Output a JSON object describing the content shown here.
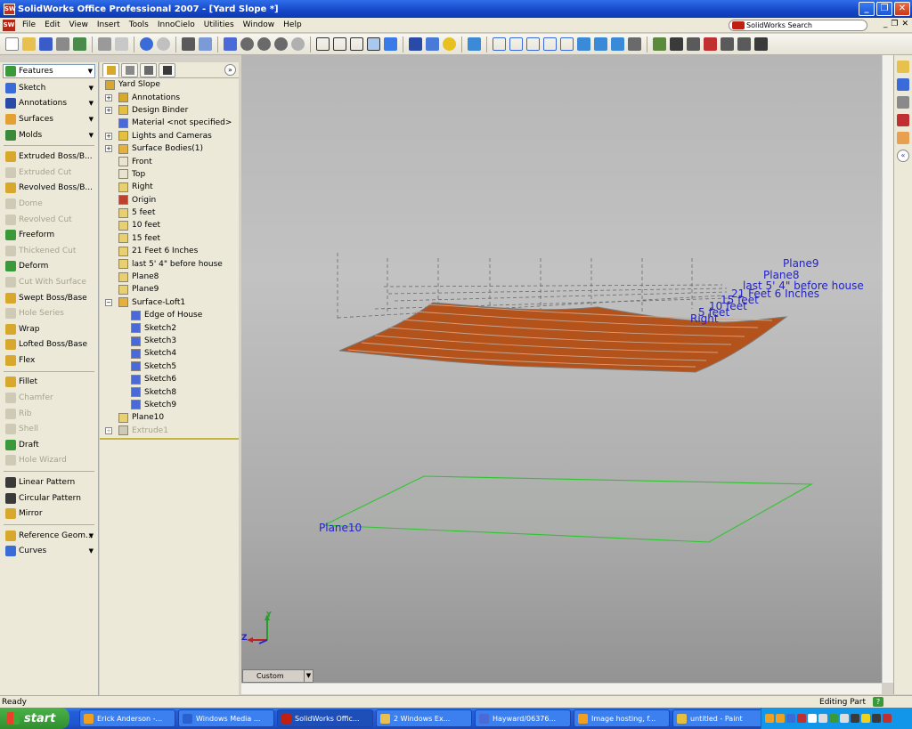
{
  "window": {
    "title": "SolidWorks Office Professional 2007 - [Yard Slope *]",
    "app_icon": "SW"
  },
  "menu": {
    "items": [
      "File",
      "Edit",
      "View",
      "Insert",
      "Tools",
      "InnoCielo",
      "Utilities",
      "Window",
      "Help"
    ],
    "search_placeholder": "SolidWorks Search"
  },
  "command_manager": {
    "selected_tab": "Features",
    "groups": [
      "Sketch",
      "Annotations",
      "Surfaces",
      "Molds"
    ],
    "features": [
      {
        "label": "Extruded Boss/B...",
        "enabled": true,
        "icon": "extrude-boss-icon",
        "color": "#d8a82c"
      },
      {
        "label": "Extruded Cut",
        "enabled": false,
        "icon": "extrude-cut-icon",
        "color": "#cfcab5"
      },
      {
        "label": "Revolved Boss/B...",
        "enabled": true,
        "icon": "revolve-boss-icon",
        "color": "#d8a82c"
      },
      {
        "label": "Dome",
        "enabled": false,
        "icon": "dome-icon",
        "color": "#cfcab5"
      },
      {
        "label": "Revolved Cut",
        "enabled": false,
        "icon": "revolve-cut-icon",
        "color": "#cfcab5"
      },
      {
        "label": "Freeform",
        "enabled": true,
        "icon": "freeform-icon",
        "color": "#3a9a3a"
      },
      {
        "label": "Thickened Cut",
        "enabled": false,
        "icon": "thicken-cut-icon",
        "color": "#cfcab5"
      },
      {
        "label": "Deform",
        "enabled": true,
        "icon": "deform-icon",
        "color": "#3a9a3a"
      },
      {
        "label": "Cut With Surface",
        "enabled": false,
        "icon": "cut-surface-icon",
        "color": "#cfcab5"
      },
      {
        "label": "Swept Boss/Base",
        "enabled": true,
        "icon": "sweep-icon",
        "color": "#d8a82c"
      },
      {
        "label": "Hole Series",
        "enabled": false,
        "icon": "hole-series-icon",
        "color": "#cfcab5"
      },
      {
        "label": "Wrap",
        "enabled": true,
        "icon": "wrap-icon",
        "color": "#d8a82c"
      },
      {
        "label": "Lofted Boss/Base",
        "enabled": true,
        "icon": "loft-icon",
        "color": "#d8a82c"
      },
      {
        "label": "Flex",
        "enabled": true,
        "icon": "flex-icon",
        "color": "#d8a82c"
      },
      {
        "sep": true
      },
      {
        "label": "Fillet",
        "enabled": true,
        "icon": "fillet-icon",
        "color": "#d8a82c"
      },
      {
        "label": "Chamfer",
        "enabled": false,
        "icon": "chamfer-icon",
        "color": "#cfcab5"
      },
      {
        "label": "Rib",
        "enabled": false,
        "icon": "rib-icon",
        "color": "#cfcab5"
      },
      {
        "label": "Shell",
        "enabled": false,
        "icon": "shell-icon",
        "color": "#cfcab5"
      },
      {
        "label": "Draft",
        "enabled": true,
        "icon": "draft-icon",
        "color": "#3a9a3a"
      },
      {
        "label": "Hole Wizard",
        "enabled": false,
        "icon": "hole-wizard-icon",
        "color": "#cfcab5"
      },
      {
        "sep": true
      },
      {
        "label": "Linear Pattern",
        "enabled": true,
        "icon": "linear-pattern-icon",
        "color": "#3a3a3a"
      },
      {
        "label": "Circular Pattern",
        "enabled": true,
        "icon": "circular-pattern-icon",
        "color": "#3a3a3a"
      },
      {
        "label": "Mirror",
        "enabled": true,
        "icon": "mirror-icon",
        "color": "#d8a82c"
      },
      {
        "sep": true
      },
      {
        "label": "Reference Geom...",
        "enabled": true,
        "icon": "reference-geometry-icon",
        "color": "#d8a82c",
        "dropdown": true
      },
      {
        "label": "Curves",
        "enabled": true,
        "icon": "curves-icon",
        "color": "#3a6bd8",
        "dropdown": true
      }
    ]
  },
  "feature_tree": {
    "items": [
      {
        "label": "Yard Slope",
        "indent": 0,
        "icon": "part-icon",
        "color": "#d8a82c",
        "plus": false
      },
      {
        "label": "Annotations",
        "indent": 1,
        "icon": "annotations-icon",
        "color": "#d8a82c",
        "plus": true
      },
      {
        "label": "Design Binder",
        "indent": 1,
        "icon": "design-binder-icon",
        "color": "#e4c040",
        "plus": true
      },
      {
        "label": "Material <not specified>",
        "indent": 1,
        "icon": "material-icon",
        "color": "#4a6ad8",
        "plus": false
      },
      {
        "label": "Lights and Cameras",
        "indent": 1,
        "icon": "lights-icon",
        "color": "#e4c040",
        "plus": true
      },
      {
        "label": "Surface Bodies(1)",
        "indent": 1,
        "icon": "surface-bodies-icon",
        "color": "#e4b040",
        "plus": true
      },
      {
        "label": "Front",
        "indent": 1,
        "icon": "plane-icon",
        "color": "#e8e4d0",
        "plus": false
      },
      {
        "label": "Top",
        "indent": 1,
        "icon": "plane-icon",
        "color": "#e8e4d0",
        "plus": false
      },
      {
        "label": "Right",
        "indent": 1,
        "icon": "plane-icon",
        "color": "#e8d070",
        "plus": false
      },
      {
        "label": "Origin",
        "indent": 1,
        "icon": "origin-icon",
        "color": "#c04030",
        "plus": false
      },
      {
        "label": "5 feet",
        "indent": 1,
        "icon": "plane-icon",
        "color": "#e8d070",
        "plus": false
      },
      {
        "label": "10 feet",
        "indent": 1,
        "icon": "plane-icon",
        "color": "#e8d070",
        "plus": false
      },
      {
        "label": "15 feet",
        "indent": 1,
        "icon": "plane-icon",
        "color": "#e8d070",
        "plus": false
      },
      {
        "label": "21 Feet 6 Inches",
        "indent": 1,
        "icon": "plane-icon",
        "color": "#e8d070",
        "plus": false
      },
      {
        "label": "last 5' 4\" before house",
        "indent": 1,
        "icon": "plane-icon",
        "color": "#e8d070",
        "plus": false
      },
      {
        "label": "Plane8",
        "indent": 1,
        "icon": "plane-icon",
        "color": "#e8d070",
        "plus": false
      },
      {
        "label": "Plane9",
        "indent": 1,
        "icon": "plane-icon",
        "color": "#e8d070",
        "plus": false
      },
      {
        "label": "Surface-Loft1",
        "indent": 1,
        "icon": "surface-loft-icon",
        "color": "#e4b040",
        "minus": true
      },
      {
        "label": "Edge of House",
        "indent": 2,
        "icon": "sketch-icon",
        "color": "#4a6ad8",
        "plus": false
      },
      {
        "label": "Sketch2",
        "indent": 2,
        "icon": "sketch-icon",
        "color": "#4a6ad8",
        "plus": false
      },
      {
        "label": "Sketch3",
        "indent": 2,
        "icon": "sketch-icon",
        "color": "#4a6ad8",
        "plus": false
      },
      {
        "label": "Sketch4",
        "indent": 2,
        "icon": "sketch-icon",
        "color": "#4a6ad8",
        "plus": false
      },
      {
        "label": "Sketch5",
        "indent": 2,
        "icon": "sketch-icon",
        "color": "#4a6ad8",
        "plus": false
      },
      {
        "label": "Sketch6",
        "indent": 2,
        "icon": "sketch-icon",
        "color": "#4a6ad8",
        "plus": false
      },
      {
        "label": "Sketch8",
        "indent": 2,
        "icon": "sketch-icon",
        "color": "#4a6ad8",
        "plus": false
      },
      {
        "label": "Sketch9",
        "indent": 2,
        "icon": "sketch-icon",
        "color": "#4a6ad8",
        "plus": false
      },
      {
        "label": "Plane10",
        "indent": 1,
        "icon": "plane-icon",
        "color": "#e8d070",
        "plus": false
      },
      {
        "label": "Extrude1",
        "indent": 1,
        "icon": "extrude-icon",
        "color": "#cfcab5",
        "plus": true,
        "disabled": true
      }
    ]
  },
  "viewport": {
    "plane_labels": [
      "Plane9",
      "Plane8",
      "last 5' 4\" before house",
      "21 Feet 6 Inches",
      "15 feet",
      "10 feet",
      "5 feet",
      "Right"
    ],
    "plane10_label": "Plane10",
    "axis_z": "Z",
    "axis_y": "Y",
    "surface_color": "#b4521c",
    "plane_outline_color": "#2fc42f",
    "label_color": "#2323c8"
  },
  "view_tab": "Custom",
  "status": {
    "left": "Ready",
    "right": "Editing Part",
    "help": "?"
  },
  "taskbar": {
    "start": "start",
    "buttons": [
      {
        "label": "Erick Anderson -...",
        "icon": "browser-icon",
        "color": "#f0a020",
        "active": false
      },
      {
        "label": "Windows Media ...",
        "icon": "media-player-icon",
        "color": "#2a5fd0",
        "active": false
      },
      {
        "label": "SolidWorks Offic...",
        "icon": "solidworks-icon",
        "color": "#c02010",
        "active": true
      },
      {
        "label": "2 Windows Ex...",
        "icon": "folder-icon",
        "color": "#e8c050",
        "active": false
      },
      {
        "label": "Hayward/06376...",
        "icon": "document-icon",
        "color": "#4a6ad8",
        "active": false
      },
      {
        "label": "Image hosting, f...",
        "icon": "browser-icon",
        "color": "#f0a020",
        "active": false
      },
      {
        "label": "untitled - Paint",
        "icon": "paint-icon",
        "color": "#e4c040",
        "active": false
      }
    ]
  }
}
